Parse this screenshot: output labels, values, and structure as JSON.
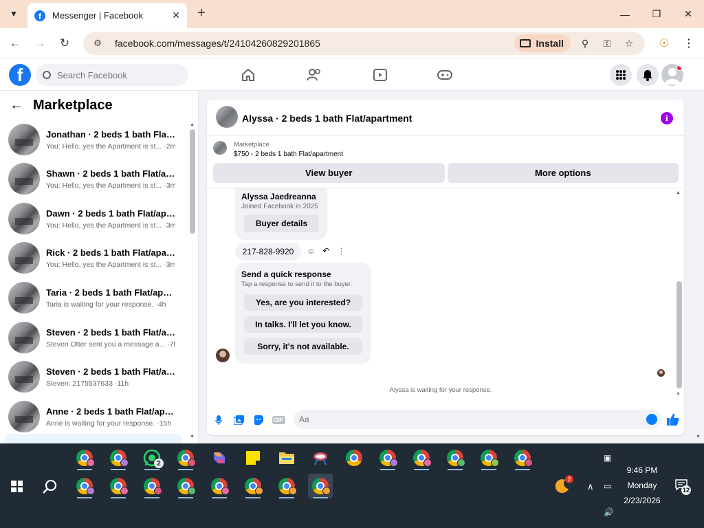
{
  "browser": {
    "tab_title": "Messenger | Facebook",
    "url": "facebook.com/messages/t/24104260829201865",
    "install_label": "Install"
  },
  "fb": {
    "search_placeholder": "Search Facebook"
  },
  "sidebar": {
    "title": "Marketplace",
    "conversations": [
      {
        "name": "Jonathan · 2 beds 1 bath Flat/ap...",
        "preview": "You: Hello, yes the Apartment is st... ·2m"
      },
      {
        "name": "Shawn · 2 beds 1 bath Flat/apar...",
        "preview": "You: Hello, yes the Apartment is st... ·3m"
      },
      {
        "name": "Dawn · 2 beds 1 bath Flat/apart...",
        "preview": "You: Hello, yes the Apartment is st... ·3m"
      },
      {
        "name": "Rick · 2 beds 1 bath Flat/apartm...",
        "preview": "You: Hello, yes the Apartment is st... ·3m"
      },
      {
        "name": "Taria · 2 beds 1 bath Flat/apart...",
        "preview": "Taria is waiting for your response. ·4h"
      },
      {
        "name": "Steven · 2 beds 1 bath Flat/apar...",
        "preview": "Steven Otter sent you a message a... ·7h"
      },
      {
        "name": "Steven · 2 beds 1 bath Flat/apar...",
        "preview": "Steven: 2175537633 ·11h"
      },
      {
        "name": "Anne · 2 beds 1 bath Flat/apart...",
        "preview": "Anne is waiting for your response. ·15h"
      }
    ]
  },
  "chat": {
    "title": "Alyssa · 2 beds 1 bath Flat/apartment",
    "marketplace_label": "Marketplace",
    "listing": "$750 - 2 beds 1 bath Flat/apartment",
    "view_buyer": "View buyer",
    "more_options": "More options",
    "buyer_name": "Alyssa Jaedreanna",
    "joined": "Joined Facebook in 2025",
    "buyer_details": "Buyer details",
    "phone": "217-828-9920",
    "quick_title": "Send a quick response",
    "quick_sub": "Tap a response to send it to the buyer.",
    "quick_responses": [
      "Yes, are you interested?",
      "In talks. I'll let you know.",
      "Sorry, it's not available."
    ],
    "waiting": "Alyssa is waiting for your response.",
    "composer_placeholder": "Aa",
    "icons": [
      "microphone-icon",
      "photo-icon",
      "sticker-icon",
      "gif-icon"
    ],
    "accent": "#0a7cff"
  },
  "taskbar": {
    "whatsapp_badge": "2",
    "weather_badge": "2",
    "time": "9:46 PM",
    "day": "Monday",
    "date": "2/23/2026",
    "notif_count": "12"
  }
}
